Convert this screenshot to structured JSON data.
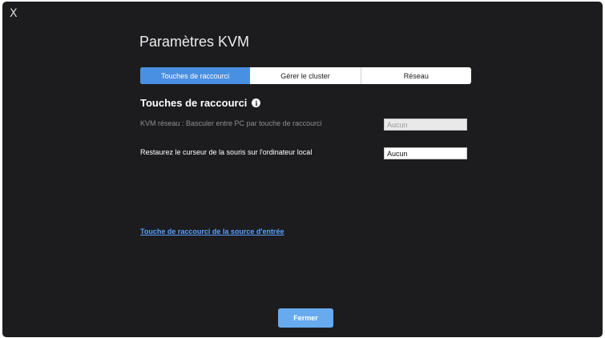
{
  "window": {
    "close_glyph": "X",
    "title": "Paramètres KVM"
  },
  "tabs": [
    {
      "label": "Touches de raccourci",
      "active": true
    },
    {
      "label": "Gérer le cluster",
      "active": false
    },
    {
      "label": "Réseau",
      "active": false
    }
  ],
  "section": {
    "heading": "Touches de raccourci",
    "info_icon": "info-icon",
    "info_glyph": "i"
  },
  "rows": [
    {
      "label": "KVM réseau : Basculer entre PC par touche de raccourci",
      "value": "Aucun",
      "enabled": false
    },
    {
      "label": "Restaurez le curseur de la souris sur l'ordinateur local",
      "value": "Aucun",
      "enabled": true
    }
  ],
  "link": {
    "label": "Touche de raccourci de la source d'entrée"
  },
  "footer": {
    "close_label": "Fermer"
  },
  "colors": {
    "background": "#1c1c1e",
    "accent": "#4a90e2",
    "button": "#67aaf0",
    "link": "#5aa0ff"
  }
}
